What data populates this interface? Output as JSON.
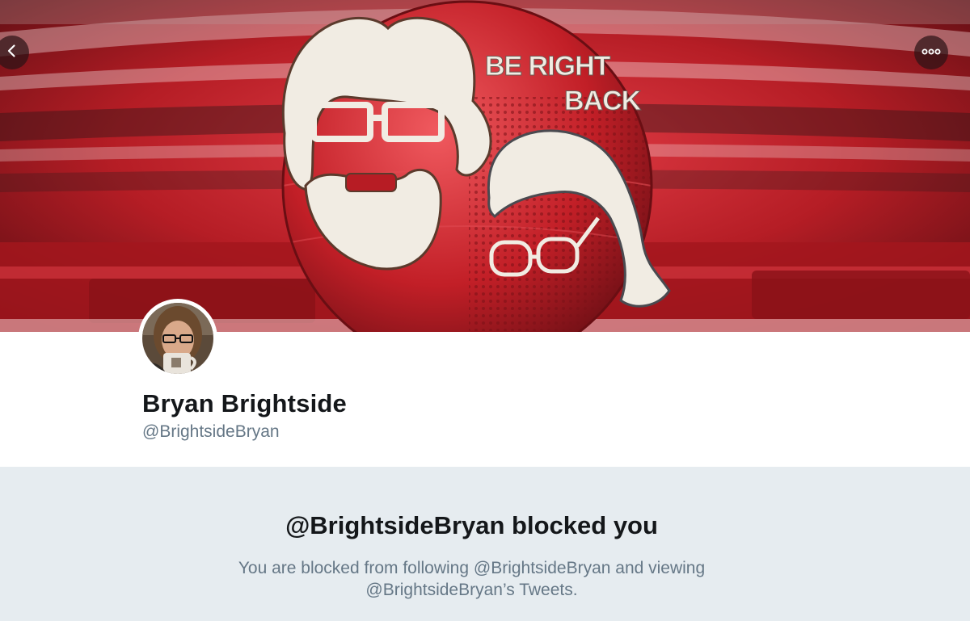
{
  "banner": {
    "headline_line1": "BE RIGHT",
    "headline_line2": "BACK"
  },
  "nav": {
    "back_icon": "chevron-left-icon",
    "more_icon": "more-horizontal-icon"
  },
  "profile": {
    "display_name": "Bryan Brightside",
    "handle": "@BrightsideBryan"
  },
  "blocked": {
    "title": "@BrightsideBryan blocked you",
    "message": "You are blocked from following @BrightsideBryan and viewing @BrightsideBryan’s Tweets."
  },
  "colors": {
    "banner_red": "#c8232b",
    "text_primary": "#14171a",
    "text_secondary": "#657786",
    "notice_background": "#e6ecf0"
  }
}
